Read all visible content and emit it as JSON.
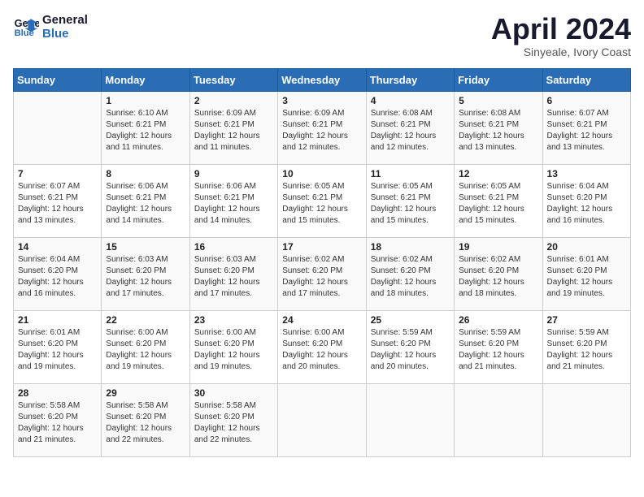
{
  "header": {
    "logo_line1": "General",
    "logo_line2": "Blue",
    "month_title": "April 2024",
    "location": "Sinyeale, Ivory Coast"
  },
  "weekdays": [
    "Sunday",
    "Monday",
    "Tuesday",
    "Wednesday",
    "Thursday",
    "Friday",
    "Saturday"
  ],
  "weeks": [
    [
      {
        "day": "",
        "sunrise": "",
        "sunset": "",
        "daylight": ""
      },
      {
        "day": "1",
        "sunrise": "6:10 AM",
        "sunset": "6:21 PM",
        "daylight": "12 hours and 11 minutes."
      },
      {
        "day": "2",
        "sunrise": "6:09 AM",
        "sunset": "6:21 PM",
        "daylight": "12 hours and 11 minutes."
      },
      {
        "day": "3",
        "sunrise": "6:09 AM",
        "sunset": "6:21 PM",
        "daylight": "12 hours and 12 minutes."
      },
      {
        "day": "4",
        "sunrise": "6:08 AM",
        "sunset": "6:21 PM",
        "daylight": "12 hours and 12 minutes."
      },
      {
        "day": "5",
        "sunrise": "6:08 AM",
        "sunset": "6:21 PM",
        "daylight": "12 hours and 13 minutes."
      },
      {
        "day": "6",
        "sunrise": "6:07 AM",
        "sunset": "6:21 PM",
        "daylight": "12 hours and 13 minutes."
      }
    ],
    [
      {
        "day": "7",
        "sunrise": "6:07 AM",
        "sunset": "6:21 PM",
        "daylight": "12 hours and 13 minutes."
      },
      {
        "day": "8",
        "sunrise": "6:06 AM",
        "sunset": "6:21 PM",
        "daylight": "12 hours and 14 minutes."
      },
      {
        "day": "9",
        "sunrise": "6:06 AM",
        "sunset": "6:21 PM",
        "daylight": "12 hours and 14 minutes."
      },
      {
        "day": "10",
        "sunrise": "6:05 AM",
        "sunset": "6:21 PM",
        "daylight": "12 hours and 15 minutes."
      },
      {
        "day": "11",
        "sunrise": "6:05 AM",
        "sunset": "6:21 PM",
        "daylight": "12 hours and 15 minutes."
      },
      {
        "day": "12",
        "sunrise": "6:05 AM",
        "sunset": "6:21 PM",
        "daylight": "12 hours and 15 minutes."
      },
      {
        "day": "13",
        "sunrise": "6:04 AM",
        "sunset": "6:20 PM",
        "daylight": "12 hours and 16 minutes."
      }
    ],
    [
      {
        "day": "14",
        "sunrise": "6:04 AM",
        "sunset": "6:20 PM",
        "daylight": "12 hours and 16 minutes."
      },
      {
        "day": "15",
        "sunrise": "6:03 AM",
        "sunset": "6:20 PM",
        "daylight": "12 hours and 17 minutes."
      },
      {
        "day": "16",
        "sunrise": "6:03 AM",
        "sunset": "6:20 PM",
        "daylight": "12 hours and 17 minutes."
      },
      {
        "day": "17",
        "sunrise": "6:02 AM",
        "sunset": "6:20 PM",
        "daylight": "12 hours and 17 minutes."
      },
      {
        "day": "18",
        "sunrise": "6:02 AM",
        "sunset": "6:20 PM",
        "daylight": "12 hours and 18 minutes."
      },
      {
        "day": "19",
        "sunrise": "6:02 AM",
        "sunset": "6:20 PM",
        "daylight": "12 hours and 18 minutes."
      },
      {
        "day": "20",
        "sunrise": "6:01 AM",
        "sunset": "6:20 PM",
        "daylight": "12 hours and 19 minutes."
      }
    ],
    [
      {
        "day": "21",
        "sunrise": "6:01 AM",
        "sunset": "6:20 PM",
        "daylight": "12 hours and 19 minutes."
      },
      {
        "day": "22",
        "sunrise": "6:00 AM",
        "sunset": "6:20 PM",
        "daylight": "12 hours and 19 minutes."
      },
      {
        "day": "23",
        "sunrise": "6:00 AM",
        "sunset": "6:20 PM",
        "daylight": "12 hours and 19 minutes."
      },
      {
        "day": "24",
        "sunrise": "6:00 AM",
        "sunset": "6:20 PM",
        "daylight": "12 hours and 20 minutes."
      },
      {
        "day": "25",
        "sunrise": "5:59 AM",
        "sunset": "6:20 PM",
        "daylight": "12 hours and 20 minutes."
      },
      {
        "day": "26",
        "sunrise": "5:59 AM",
        "sunset": "6:20 PM",
        "daylight": "12 hours and 21 minutes."
      },
      {
        "day": "27",
        "sunrise": "5:59 AM",
        "sunset": "6:20 PM",
        "daylight": "12 hours and 21 minutes."
      }
    ],
    [
      {
        "day": "28",
        "sunrise": "5:58 AM",
        "sunset": "6:20 PM",
        "daylight": "12 hours and 21 minutes."
      },
      {
        "day": "29",
        "sunrise": "5:58 AM",
        "sunset": "6:20 PM",
        "daylight": "12 hours and 22 minutes."
      },
      {
        "day": "30",
        "sunrise": "5:58 AM",
        "sunset": "6:20 PM",
        "daylight": "12 hours and 22 minutes."
      },
      {
        "day": "",
        "sunrise": "",
        "sunset": "",
        "daylight": ""
      },
      {
        "day": "",
        "sunrise": "",
        "sunset": "",
        "daylight": ""
      },
      {
        "day": "",
        "sunrise": "",
        "sunset": "",
        "daylight": ""
      },
      {
        "day": "",
        "sunrise": "",
        "sunset": "",
        "daylight": ""
      }
    ]
  ],
  "labels": {
    "sunrise": "Sunrise:",
    "sunset": "Sunset:",
    "daylight": "Daylight:"
  }
}
